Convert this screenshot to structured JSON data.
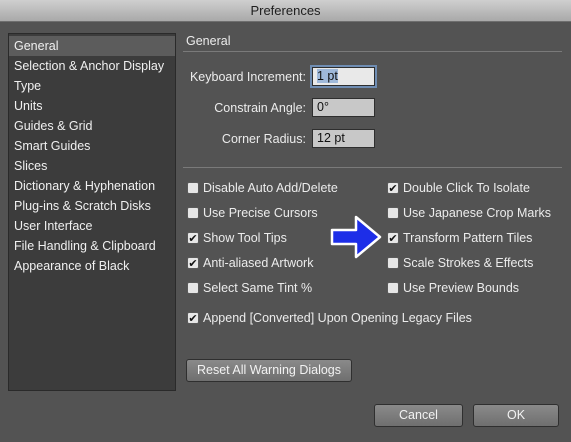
{
  "window": {
    "title": "Preferences"
  },
  "sidebar": {
    "items": [
      {
        "label": "General",
        "selected": true
      },
      {
        "label": "Selection & Anchor Display"
      },
      {
        "label": "Type"
      },
      {
        "label": "Units"
      },
      {
        "label": "Guides & Grid"
      },
      {
        "label": "Smart Guides"
      },
      {
        "label": "Slices"
      },
      {
        "label": "Dictionary & Hyphenation"
      },
      {
        "label": "Plug-ins & Scratch Disks"
      },
      {
        "label": "User Interface"
      },
      {
        "label": "File Handling & Clipboard"
      },
      {
        "label": "Appearance of Black"
      }
    ]
  },
  "general": {
    "section_title": "General",
    "keyboard_increment": {
      "label": "Keyboard Increment:",
      "value": "1 pt"
    },
    "constrain_angle": {
      "label": "Constrain Angle:",
      "value": "0°"
    },
    "corner_radius": {
      "label": "Corner Radius:",
      "value": "12 pt"
    }
  },
  "options": {
    "disable_auto_add": {
      "label": "Disable Auto Add/Delete",
      "checked": false
    },
    "double_click_isolate": {
      "label": "Double Click To Isolate",
      "checked": true
    },
    "precise_cursors": {
      "label": "Use Precise Cursors",
      "checked": false
    },
    "japanese_crop": {
      "label": "Use Japanese Crop Marks",
      "checked": false
    },
    "show_tool_tips": {
      "label": "Show Tool Tips",
      "checked": true
    },
    "transform_pattern": {
      "label": "Transform Pattern Tiles",
      "checked": true
    },
    "anti_aliased": {
      "label": "Anti-aliased Artwork",
      "checked": true
    },
    "scale_strokes": {
      "label": "Scale Strokes & Effects",
      "checked": false
    },
    "same_tint": {
      "label": "Select Same Tint %",
      "checked": false
    },
    "preview_bounds": {
      "label": "Use Preview Bounds",
      "checked": false
    },
    "append_converted": {
      "label": "Append [Converted] Upon Opening Legacy Files",
      "checked": true
    }
  },
  "buttons": {
    "reset_warnings": "Reset All Warning Dialogs",
    "cancel": "Cancel",
    "ok": "OK"
  },
  "check_mark": "✔",
  "colors": {
    "arrow": "#1d2ee8",
    "focus_ring": "#6f8db3"
  }
}
